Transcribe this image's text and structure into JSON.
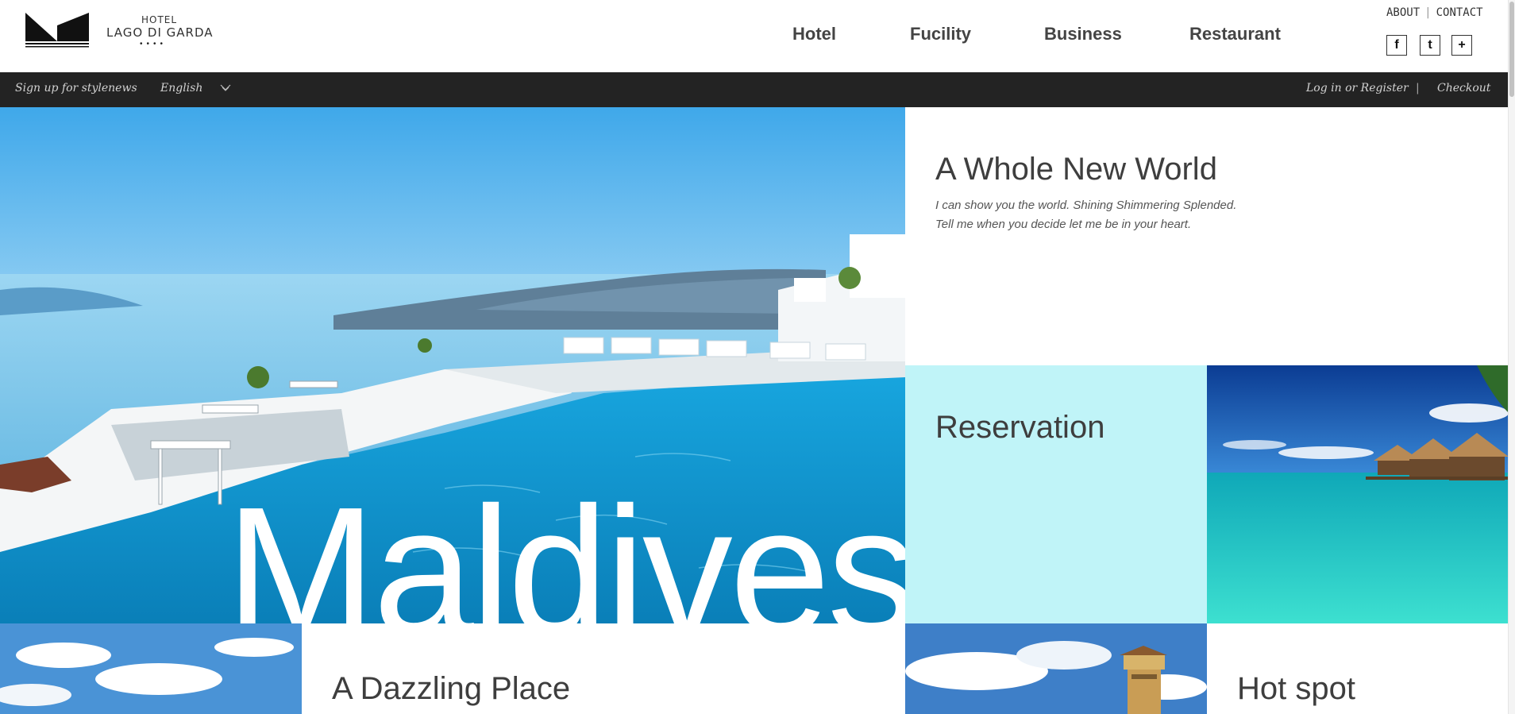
{
  "brand": {
    "line1": "HOTEL",
    "line2": "LAGO DI GARDA",
    "stars": "••••"
  },
  "nav": {
    "items": [
      "Hotel",
      "Fucility",
      "Business",
      "Restaurant"
    ]
  },
  "top_links": {
    "about": "ABOUT",
    "separator": "|",
    "contact": "CONTACT"
  },
  "social": {
    "facebook": "f",
    "twitter": "t",
    "plus": "+"
  },
  "bar": {
    "signup": "Sign up for stylenews",
    "language": "English",
    "login": "Log in or Register",
    "separator": "|",
    "checkout": "Checkout"
  },
  "hero": {
    "word": "Maldives"
  },
  "feature": {
    "title": "A Whole New World",
    "line1": "I can show you the world. Shining Shimmering Splended.",
    "line2": "Tell me when you decide let me be in your heart."
  },
  "reservation": {
    "title": "Reservation"
  },
  "dazzle": {
    "title": "A Dazzling Place"
  },
  "hotspot": {
    "title": "Hot spot"
  },
  "colors": {
    "bar_bg": "#232323",
    "reservation_bg": "#c0f4f8",
    "text_dark": "#3e3e3e"
  },
  "icons": [
    "logo-mark",
    "chevron-down-icon",
    "facebook-icon",
    "twitter-icon",
    "plus-icon"
  ]
}
